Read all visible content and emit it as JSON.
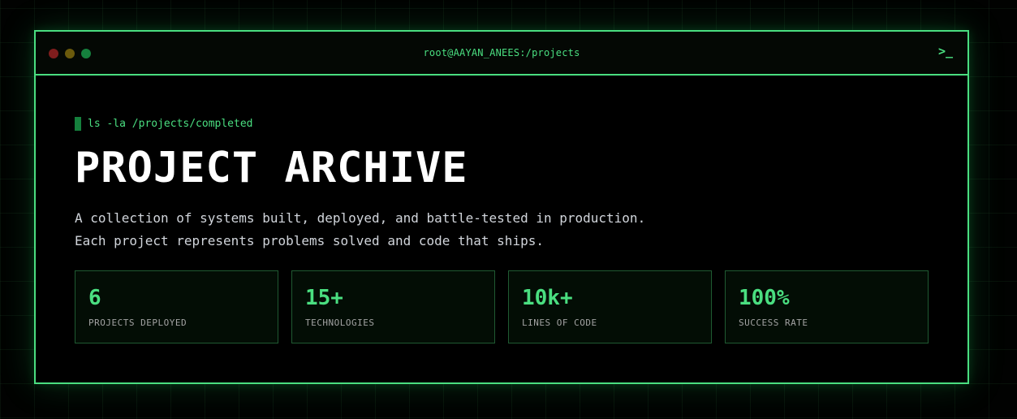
{
  "window": {
    "title": "root@AAYAN_ANEES:/projects",
    "prompt_icon": ">_",
    "controls": [
      "close",
      "minimize",
      "maximize"
    ]
  },
  "hero": {
    "command": "ls -la /projects/completed",
    "title": "PROJECT ARCHIVE",
    "description_line1": "A collection of systems built, deployed, and battle-tested in production.",
    "description_line2": "Each project represents problems solved and code that ships."
  },
  "stats": [
    {
      "value": "6",
      "label": "PROJECTS DEPLOYED"
    },
    {
      "value": "15+",
      "label": "TECHNOLOGIES"
    },
    {
      "value": "10k+",
      "label": "LINES OF CODE"
    },
    {
      "value": "100%",
      "label": "SUCCESS RATE"
    }
  ],
  "colors": {
    "accent": "#4ade80",
    "background": "#000000",
    "dot_red": "#7f1d1d",
    "dot_yellow": "#6b5a0c",
    "dot_green": "#15803d"
  }
}
